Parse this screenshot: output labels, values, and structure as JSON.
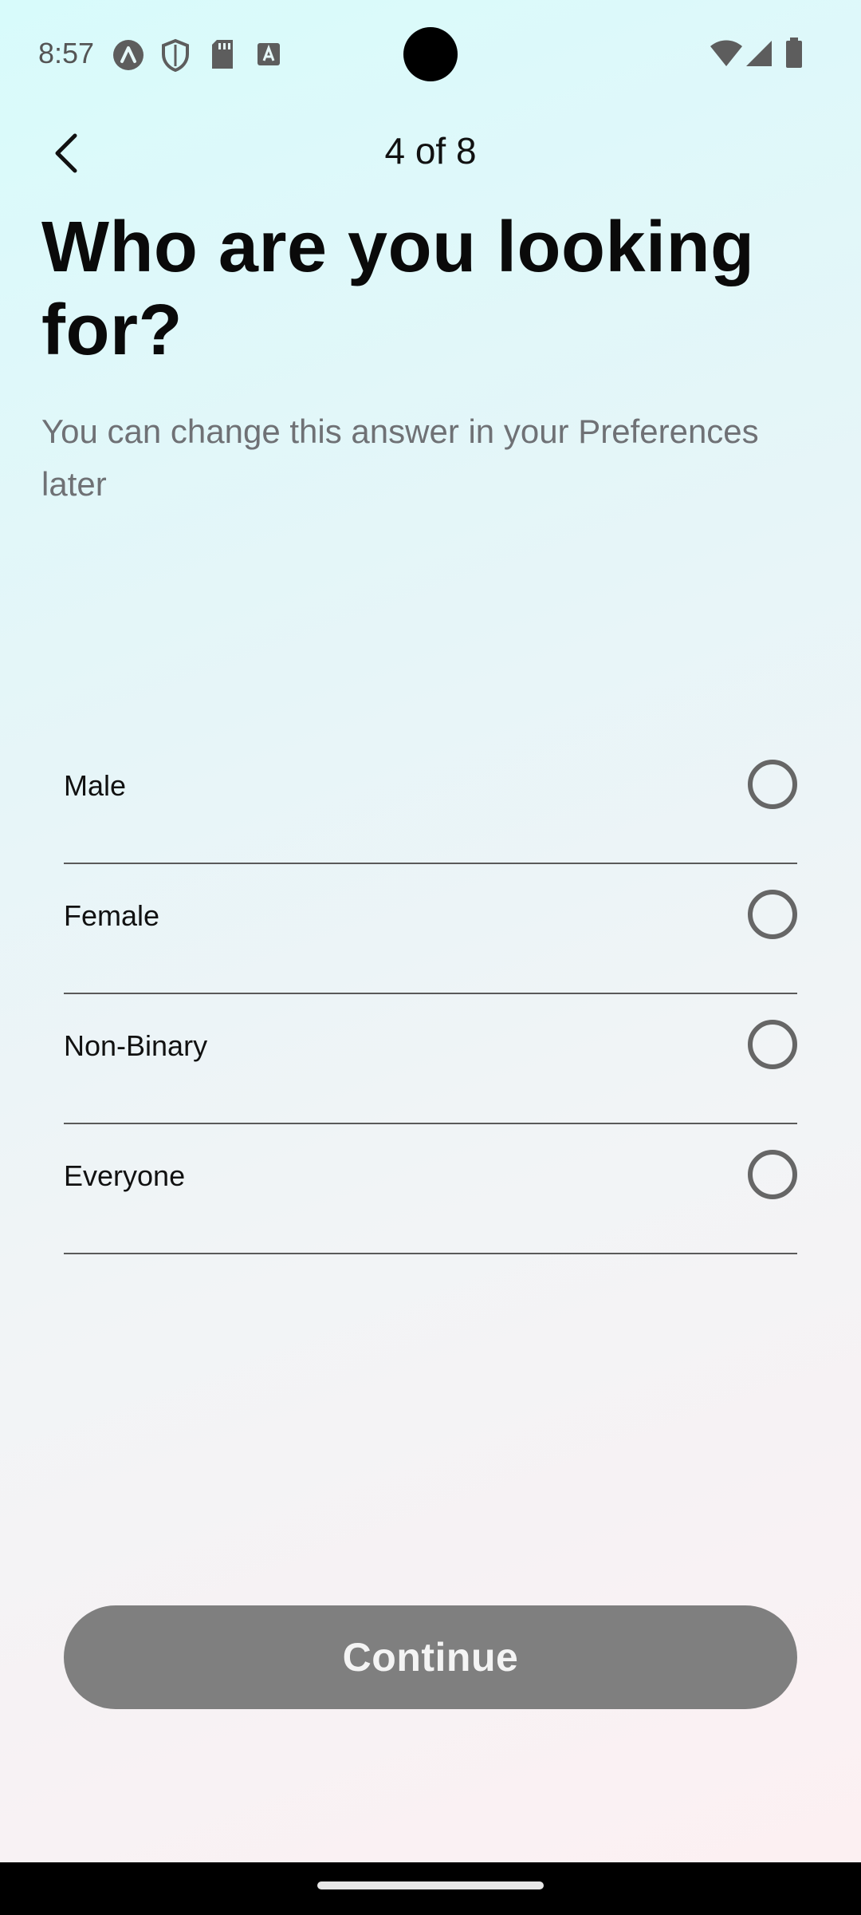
{
  "status_bar": {
    "time": "8:57",
    "left_icons": [
      "app-a-icon",
      "shield-icon",
      "sd-card-icon",
      "keyboard-a-icon"
    ],
    "right_icons": [
      "wifi-icon",
      "signal-icon",
      "battery-icon"
    ]
  },
  "header": {
    "step": "4 of 8",
    "back_icon": "chevron-left-icon"
  },
  "main": {
    "title": "Who are you looking for?",
    "subtitle": "You can change this answer in your Preferences later",
    "options": [
      {
        "label": "Male",
        "selected": false
      },
      {
        "label": "Female",
        "selected": false
      },
      {
        "label": "Non-Binary",
        "selected": false
      },
      {
        "label": "Everyone",
        "selected": false
      }
    ]
  },
  "footer": {
    "continue_label": "Continue"
  },
  "colors": {
    "button_disabled": "#7f7f7f",
    "title": "#0a0a0a",
    "subtitle": "#6f7175",
    "divider": "#5a5a5a"
  }
}
